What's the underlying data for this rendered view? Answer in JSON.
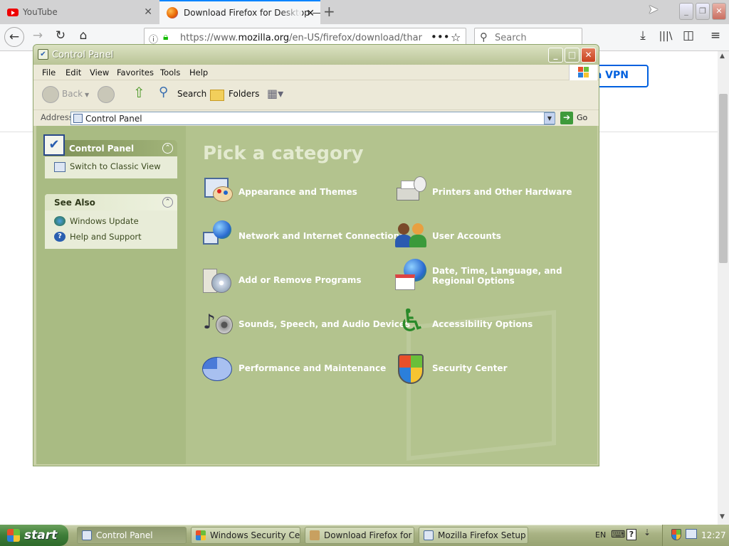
{
  "browser": {
    "tabs": [
      {
        "label": "YouTube",
        "active": false
      },
      {
        "label": "Download Firefox for Desktop — F",
        "active": true
      }
    ],
    "url_prefix": "https://www.",
    "url_domain": "mozilla.org",
    "url_rest": "/en-US/firefox/download/than",
    "search_placeholder": "Search",
    "page_button_text": "a VPN"
  },
  "window": {
    "title": "Control Panel",
    "menu": [
      "File",
      "Edit",
      "View",
      "Favorites",
      "Tools",
      "Help"
    ],
    "toolbar": {
      "back": "Back",
      "search": "Search",
      "folders": "Folders"
    },
    "address_label": "Address",
    "address_value": "Control Panel",
    "go_label": "Go"
  },
  "left_pane": {
    "control_panel_heading": "Control Panel",
    "switch_link": "Switch to Classic View",
    "see_also_heading": "See Also",
    "see_also_links": [
      "Windows Update",
      "Help and Support"
    ]
  },
  "main": {
    "heading": "Pick a category",
    "categories": [
      {
        "label": "Appearance and Themes",
        "icon": "appearance-icon"
      },
      {
        "label": "Printers and Other Hardware",
        "icon": "printer-icon"
      },
      {
        "label": "Network and Internet Connections",
        "icon": "network-icon"
      },
      {
        "label": "User Accounts",
        "icon": "users-icon"
      },
      {
        "label": "Add or Remove Programs",
        "icon": "add-remove-icon"
      },
      {
        "label": "Date, Time, Language, and Regional Options",
        "icon": "calendar-globe-icon"
      },
      {
        "label": "Sounds, Speech, and Audio Devices",
        "icon": "sound-icon"
      },
      {
        "label": "Accessibility Options",
        "icon": "accessibility-icon"
      },
      {
        "label": "Performance and Maintenance",
        "icon": "pie-chart-icon"
      },
      {
        "label": "Security Center",
        "icon": "shield-icon"
      }
    ]
  },
  "taskbar": {
    "start_label": "start",
    "tasks": [
      "Control Panel",
      "Windows Security Ce...",
      "Download Firefox for ...",
      "Mozilla Firefox Setup"
    ],
    "language": "EN",
    "clock": "12:27"
  },
  "colors": {
    "xp_olive": "#a9bb83",
    "firefox_accent": "#0a84ff",
    "link_blue": "#0060df"
  }
}
